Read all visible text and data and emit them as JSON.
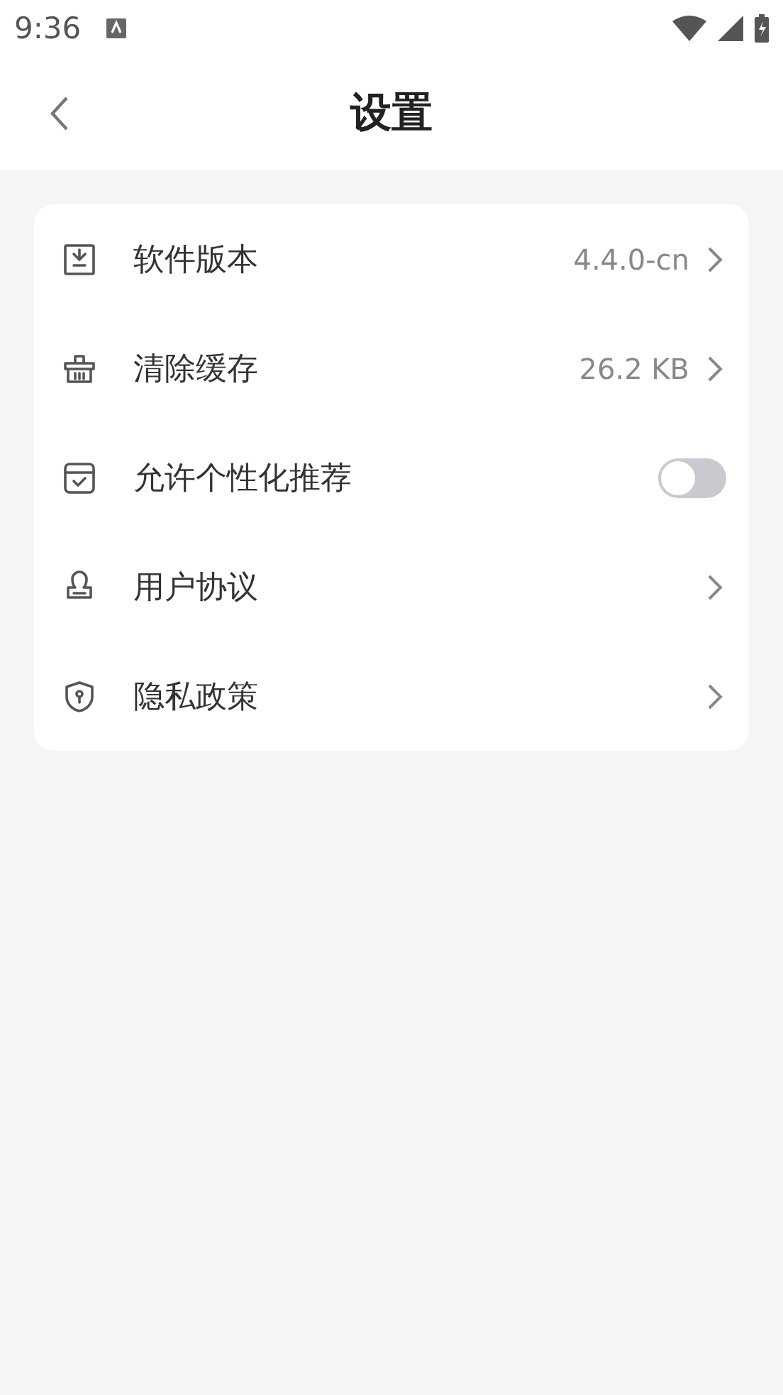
{
  "status_bar": {
    "time": "9:36"
  },
  "header": {
    "title": "设置"
  },
  "settings": [
    {
      "kind": "link",
      "label": "软件版本",
      "value": "4.4.0-cn"
    },
    {
      "kind": "link",
      "label": "清除缓存",
      "value": "26.2 KB"
    },
    {
      "kind": "toggle",
      "label": "允许个性化推荐",
      "on": false
    },
    {
      "kind": "link",
      "label": "用户协议"
    },
    {
      "kind": "link",
      "label": "隐私政策"
    }
  ]
}
